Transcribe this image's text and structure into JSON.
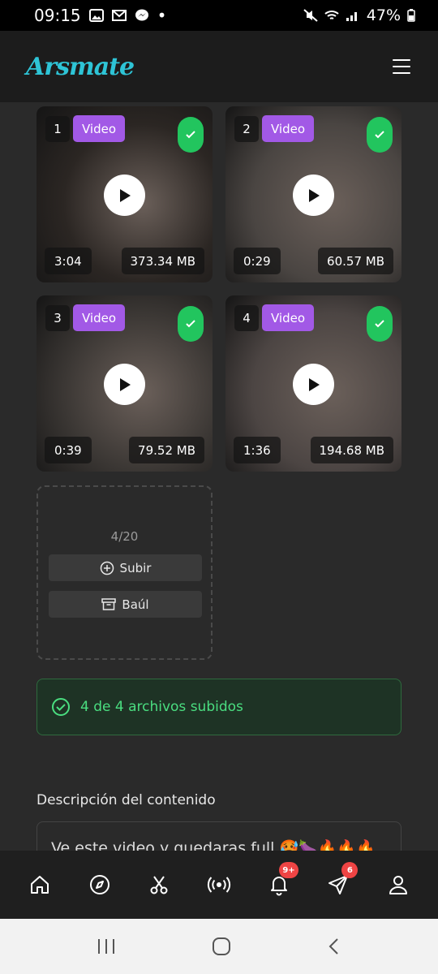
{
  "status_bar": {
    "time": "09:15",
    "dot": "•",
    "battery": "47%"
  },
  "header": {
    "logo": "Arsmate"
  },
  "tiles": [
    {
      "index": "1",
      "type_label": "Video",
      "duration": "3:04",
      "size": "373.34 MB",
      "bg": "#2b2623"
    },
    {
      "index": "2",
      "type_label": "Video",
      "duration": "0:29",
      "size": "60.57 MB",
      "bg": "#4a4542"
    },
    {
      "index": "3",
      "type_label": "Video",
      "duration": "0:39",
      "size": "79.52 MB",
      "bg": "#3b3734"
    },
    {
      "index": "4",
      "type_label": "Video",
      "duration": "1:36",
      "size": "194.68 MB",
      "bg": "#4c4543"
    }
  ],
  "upload": {
    "count": "4/20",
    "upload_label": "Subir",
    "vault_label": "Baúl"
  },
  "success": {
    "message": "4 de 4 archivos subidos"
  },
  "description": {
    "label": "Descripción del contenido",
    "value": "Ve este video y quedaras full 🥵🍆🔥🔥🔥"
  },
  "bottom_nav": {
    "items": [
      "home-icon",
      "compass-icon",
      "scissors-icon",
      "live-icon",
      "bell-icon",
      "send-icon",
      "user-icon"
    ],
    "notifications_badge": "9+",
    "messages_badge": "6"
  },
  "colors": {
    "accent": "#2ec4d6",
    "badge": "#a259e6",
    "success": "#22c55e",
    "alert": "#ef4444"
  }
}
